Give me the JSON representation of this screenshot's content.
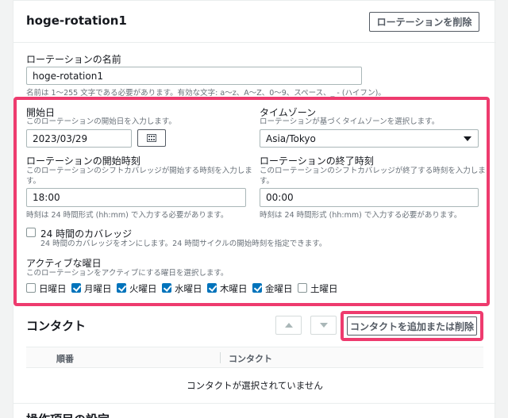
{
  "header": {
    "title": "hoge-rotation1",
    "delete_button": "ローテーションを削除"
  },
  "name_field": {
    "label": "ローテーションの名前",
    "value": "hoge-rotation1",
    "hint": "名前は 1〜255 文字である必要があります。有効な文字: a〜z、A〜Z、0〜9、スペース、_ - (ハイフン)。"
  },
  "start_date": {
    "label": "開始日",
    "description": "このローテーションの開始日を入力します。",
    "value": "2023/03/29",
    "calendar_icon": "calendar-icon"
  },
  "timezone": {
    "label": "タイムゾーン",
    "description": "ローテーションが基づくタイムゾーンを選択します。",
    "value": "Asia/Tokyo"
  },
  "start_time": {
    "label": "ローテーションの開始時刻",
    "description_line1": "このローテーションのシフトカバレッジが開始する時刻を入力しま",
    "description_line2": "す。",
    "value": "18:00",
    "hint": "時刻は 24 時間形式 (hh:mm) で入力する必要があります。"
  },
  "end_time": {
    "label": "ローテーションの終了時刻",
    "description_line1": "このローテーションのシフトカバレッジが終了する時刻を入力しま",
    "description_line2": "す。",
    "value": "00:00",
    "hint": "時刻は 24 時間形式 (hh:mm) で入力する必要があります。"
  },
  "coverage_24h": {
    "label": "24 時間のカバレッジ",
    "description": "24 時間のカバレッジをオンにします。24 時間サイクルの開始時刻を指定できます。",
    "checked": false
  },
  "active_days": {
    "label": "アクティブな曜日",
    "description": "このローテーションをアクティブにする曜日を選択します。",
    "days": [
      {
        "label": "日曜日",
        "checked": false
      },
      {
        "label": "月曜日",
        "checked": true
      },
      {
        "label": "火曜日",
        "checked": true
      },
      {
        "label": "水曜日",
        "checked": true
      },
      {
        "label": "木曜日",
        "checked": true
      },
      {
        "label": "金曜日",
        "checked": true
      },
      {
        "label": "土曜日",
        "checked": false
      }
    ]
  },
  "contacts": {
    "title": "コンタクト",
    "add_remove_button": "コンタクトを追加または削除",
    "columns": [
      "順番",
      "コンタクト"
    ],
    "empty_message": "コンタクトが選択されていません"
  },
  "next_section_title": "操作項目の設定",
  "colors": {
    "highlight": "#ee3b6e",
    "checkbox_checked": "#0073bb"
  }
}
